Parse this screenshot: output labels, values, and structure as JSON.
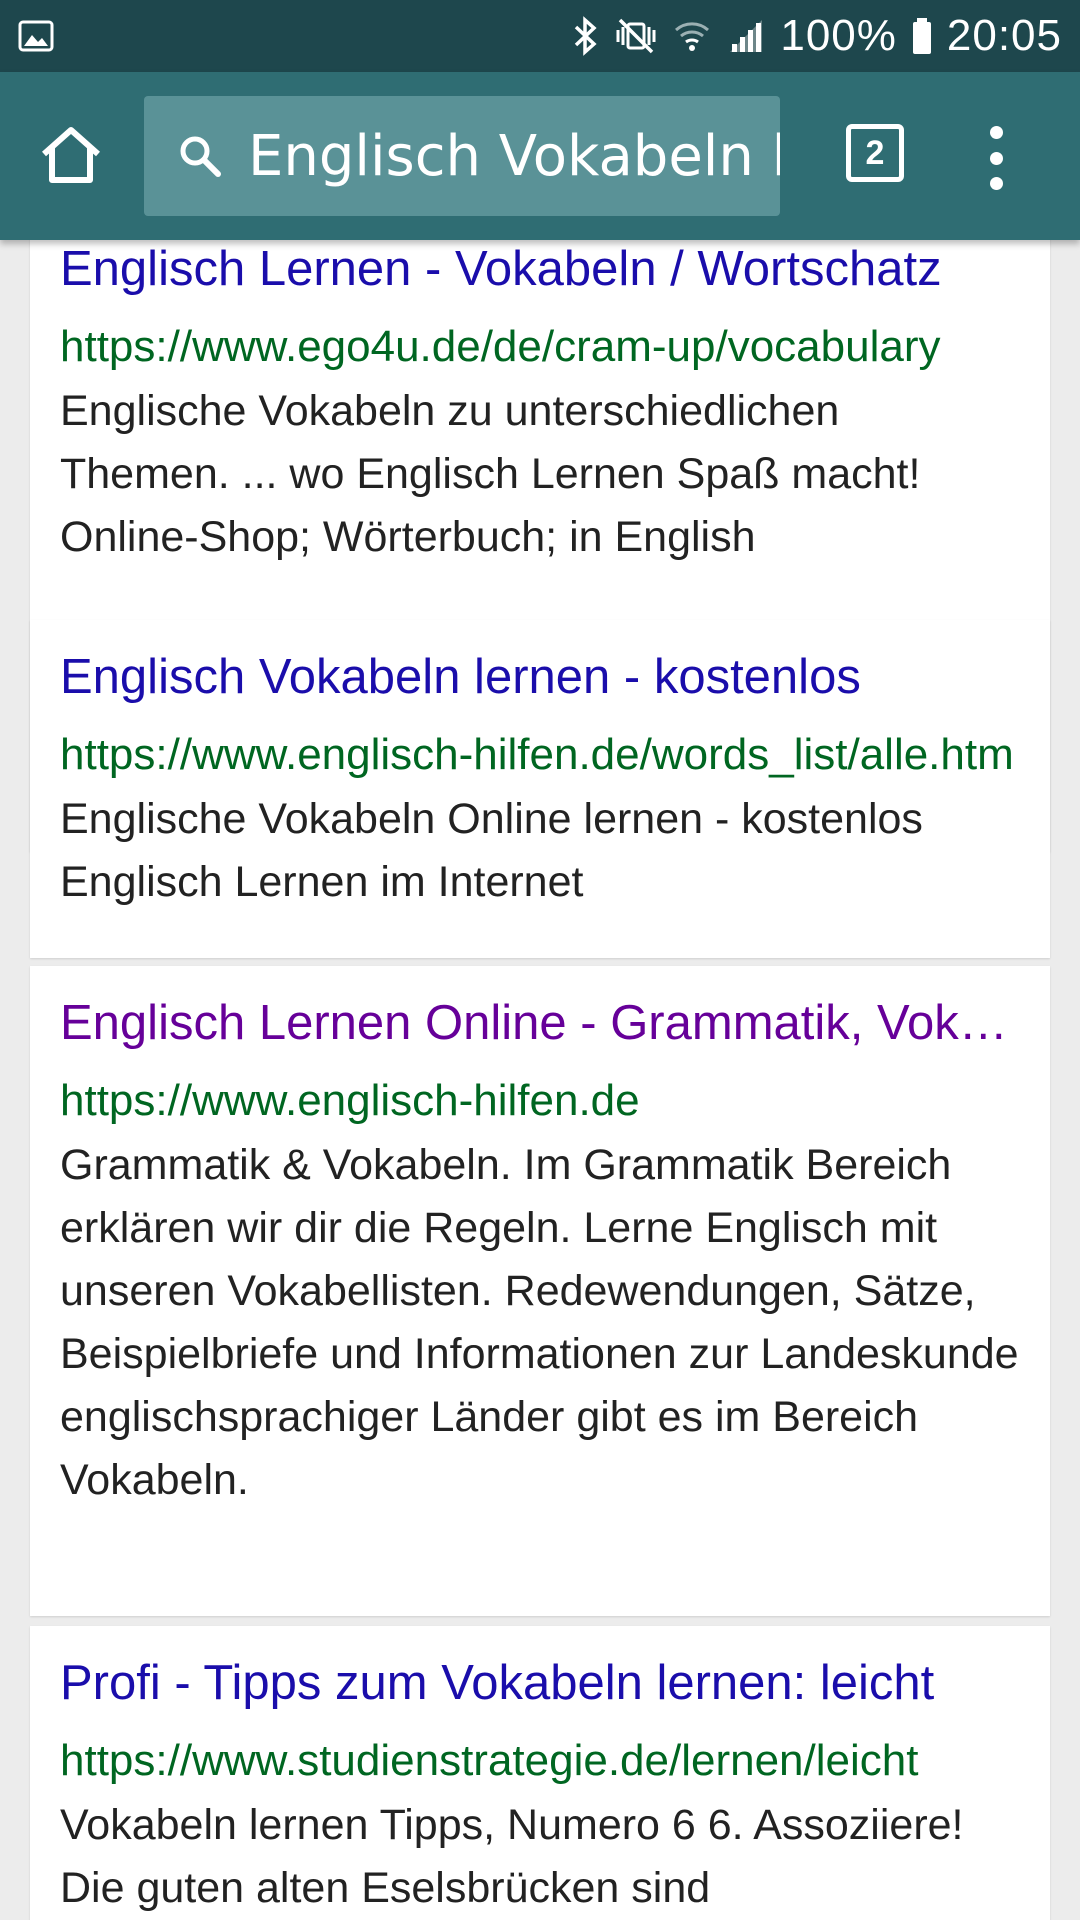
{
  "status_bar": {
    "image_icon": "image-icon",
    "bluetooth_icon": "bluetooth-icon",
    "mute_icon": "vibrate-mute-icon",
    "wifi_icon": "wifi-icon",
    "signal_icon": "signal-icon",
    "battery_text": "100%",
    "battery_icon": "battery-icon",
    "time": "20:05"
  },
  "toolbar": {
    "home_icon": "home-icon",
    "search_icon": "search-icon",
    "search_query": "Englisch Vokabeln l",
    "tab_count": "2",
    "menu_icon": "more-vert-icon"
  },
  "colors": {
    "status_bar_bg": "#1e474d",
    "toolbar_bg": "#2f6d73",
    "search_box_bg": "#5a9297",
    "link": "#1a0dab",
    "link_visited": "#660099",
    "url": "#006621"
  },
  "results": [
    {
      "title": "Englisch Lernen - Vokabeln / Wortschatz",
      "url": "https://www.ego4u.de/de/cram-up/vocabulary",
      "snippet": "Englische Vokabeln zu unterschiedlichen Themen. ... wo Englisch Lernen Spaß macht! Online-Shop; Wörterbuch; in English",
      "visited": false
    },
    {
      "title": "Englisch Vokabeln lernen - kostenlos",
      "url": "https://www.englisch-hilfen.de/words_list/alle.htm",
      "snippet": "Englische Vokabeln Online lernen - kostenlos Englisch Lernen im Internet",
      "visited": false
    },
    {
      "title": "Englisch Lernen Online - Grammatik, Vokabeln",
      "url": "https://www.englisch-hilfen.de",
      "snippet": "Grammatik & Vokabeln. Im Grammatik Bereich erklären wir dir die Regeln. Lerne Englisch mit unseren Vokabellisten. Redewendungen, Sätze, Beispielbriefe und Informationen zur Landeskunde englischsprachiger Länder gibt es im Bereich Vokabeln.",
      "visited": true
    },
    {
      "title": " Profi - Tipps zum Vokabeln lernen: leicht",
      "url": "https://www.studienstrategie.de/lernen/leicht",
      "snippet": "Vokabeln lernen Tipps, Numero 6 6. Assoziiere! Die guten alten Eselsbrücken sind",
      "visited": false
    }
  ]
}
